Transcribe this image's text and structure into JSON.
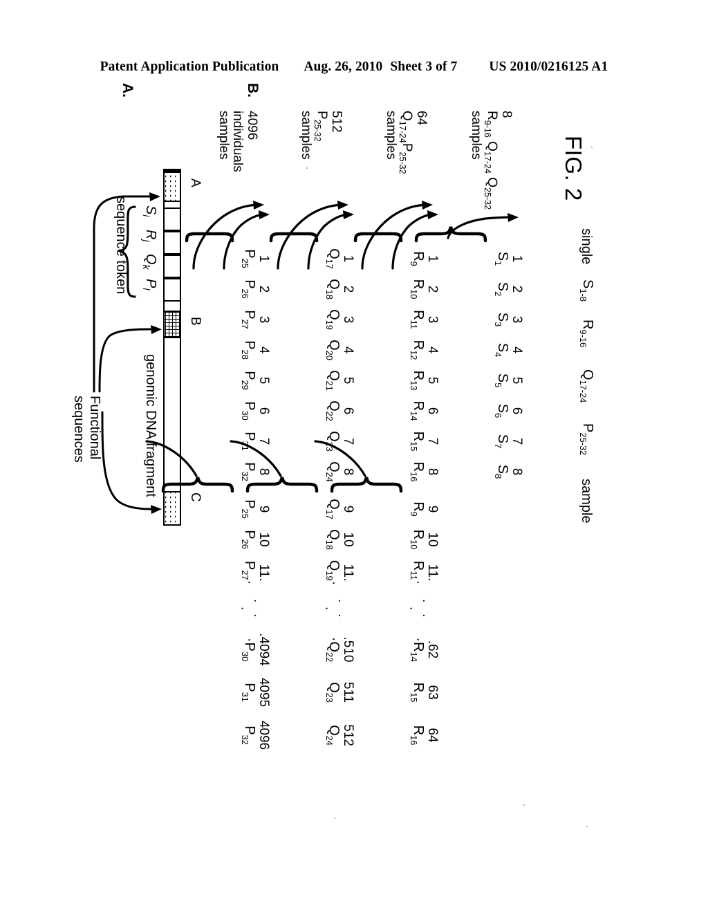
{
  "header": {
    "publication": "Patent Application Publication",
    "date": "Aug. 26, 2010",
    "sheet": "Sheet 3 of 7",
    "number": "US 2010/0216125 A1"
  },
  "figure": {
    "title": "FIG. 2",
    "panel_a_letter": "A.",
    "panel_b_letter": "B."
  },
  "panel_a": {
    "marks": {
      "a": "A",
      "b": "B",
      "c": "C"
    },
    "fragment_label": "genomic DNA fragment",
    "functional_label_line1": "Functional",
    "functional_label_line2": "sequences",
    "token_label": "sequence token",
    "tokens": [
      {
        "base": "S",
        "sub": "i"
      },
      {
        "base": "R",
        "sub": "j"
      },
      {
        "base": "Q",
        "sub": "k"
      },
      {
        "base": "P",
        "sub": "l"
      }
    ]
  },
  "panel_b": {
    "rows": [
      {
        "label_lines": [
          "4096",
          "individuals",
          "samples"
        ],
        "left_group": {
          "indices": [
            "1",
            "2",
            "3",
            "4",
            "5",
            "6",
            "7",
            "8"
          ],
          "tokens": [
            {
              "b": "P",
              "s": "25"
            },
            {
              "b": "P",
              "s": "26"
            },
            {
              "b": "P",
              "s": "27"
            },
            {
              "b": "P",
              "s": "28"
            },
            {
              "b": "P",
              "s": "29"
            },
            {
              "b": "P",
              "s": "30"
            },
            {
              "b": "P",
              "s": "31"
            },
            {
              "b": "P",
              "s": "32"
            }
          ]
        },
        "right_group": {
          "indices": [
            "9",
            "10",
            "11."
          ],
          "tokens": [
            {
              "b": "P",
              "s": "25"
            },
            {
              "b": "P",
              "s": "26"
            },
            {
              "b": "P",
              "s": "27"
            }
          ]
        },
        "tail": {
          "indices": [
            ".4094",
            "4095",
            "4096"
          ],
          "tokens": [
            {
              "b": "P",
              "s": "30"
            },
            {
              "b": "P",
              "s": "31"
            },
            {
              "b": "P",
              "s": "32"
            }
          ]
        }
      },
      {
        "label_lines": [
          "512",
          "P25-32",
          "samples"
        ],
        "label_rich": {
          "num": "512",
          "base": "P",
          "sub": "25-32",
          "word": "samples"
        },
        "left_group": {
          "indices": [
            "1",
            "2",
            "3",
            "4",
            "5",
            "6",
            "7",
            "8"
          ],
          "tokens": [
            {
              "b": "Q",
              "s": "17"
            },
            {
              "b": "Q",
              "s": "18"
            },
            {
              "b": "Q",
              "s": "19"
            },
            {
              "b": "Q",
              "s": "20"
            },
            {
              "b": "Q",
              "s": "21"
            },
            {
              "b": "Q",
              "s": "22"
            },
            {
              "b": "Q",
              "s": "23"
            },
            {
              "b": "Q",
              "s": "24"
            }
          ]
        },
        "right_group": {
          "indices": [
            "9",
            "10",
            "11."
          ],
          "tokens": [
            {
              "b": "Q",
              "s": "17"
            },
            {
              "b": "Q",
              "s": "18"
            },
            {
              "b": "Q",
              "s": "19"
            }
          ]
        },
        "tail": {
          "indices": [
            ".510",
            "511",
            "512"
          ],
          "tokens": [
            {
              "b": "Q",
              "s": "22"
            },
            {
              "b": "Q",
              "s": "23"
            },
            {
              "b": "Q",
              "s": "24"
            }
          ]
        }
      },
      {
        "label_lines": [
          "64",
          "Q17-24P25-32",
          "samples"
        ],
        "label_rich": {
          "num": "64",
          "base": "Q",
          "sub": "17-24",
          "base2": "P",
          "sub2": "25-32",
          "word": "samples"
        },
        "left_group": {
          "indices": [
            "1",
            "2",
            "3",
            "4",
            "5",
            "6",
            "7",
            "8"
          ],
          "tokens": [
            {
              "b": "R",
              "s": "9"
            },
            {
              "b": "R",
              "s": "10"
            },
            {
              "b": "R",
              "s": "11"
            },
            {
              "b": "R",
              "s": "12"
            },
            {
              "b": "R",
              "s": "13"
            },
            {
              "b": "R",
              "s": "14"
            },
            {
              "b": "R",
              "s": "15"
            },
            {
              "b": "R",
              "s": "16"
            }
          ]
        },
        "right_group": {
          "indices": [
            "9",
            "10",
            "11."
          ],
          "tokens": [
            {
              "b": "R",
              "s": "9"
            },
            {
              "b": "R",
              "s": "10"
            },
            {
              "b": "R",
              "s": "11"
            }
          ]
        },
        "tail": {
          "indices": [
            ".62",
            "63",
            "64"
          ],
          "tokens": [
            {
              "b": "R",
              "s": "14"
            },
            {
              "b": "R",
              "s": "15"
            },
            {
              "b": "R",
              "s": "16"
            }
          ]
        }
      },
      {
        "label_lines": [
          "8",
          "R9-16 Q17-24 Q25-32",
          "samples"
        ],
        "label_rich": {
          "num": "8",
          "base": "R",
          "sub": "9-16",
          "base2": "Q",
          "sub2": "17-24",
          "base3": "Q",
          "sub3": "25-32",
          "word": "samples"
        },
        "left_group": {
          "indices": [
            "1",
            "2",
            "3",
            "4",
            "5",
            "6",
            "7",
            "8"
          ],
          "tokens": [
            {
              "b": "S",
              "s": "1"
            },
            {
              "b": "S",
              "s": "2"
            },
            {
              "b": "S",
              "s": "3"
            },
            {
              "b": "S",
              "s": "4"
            },
            {
              "b": "S",
              "s": "5"
            },
            {
              "b": "S",
              "s": "6"
            },
            {
              "b": "S",
              "s": "7"
            },
            {
              "b": "S",
              "s": "8"
            }
          ]
        },
        "right_group": null,
        "tail": null
      }
    ],
    "final": {
      "word_single": "single",
      "tokens": [
        {
          "b": "S",
          "s": "1-8"
        },
        {
          "b": "R",
          "s": "9-16"
        },
        {
          "b": "Q",
          "s": "17-24"
        },
        {
          "b": "P",
          "s": "25-32"
        }
      ],
      "word_sample": "sample"
    }
  }
}
